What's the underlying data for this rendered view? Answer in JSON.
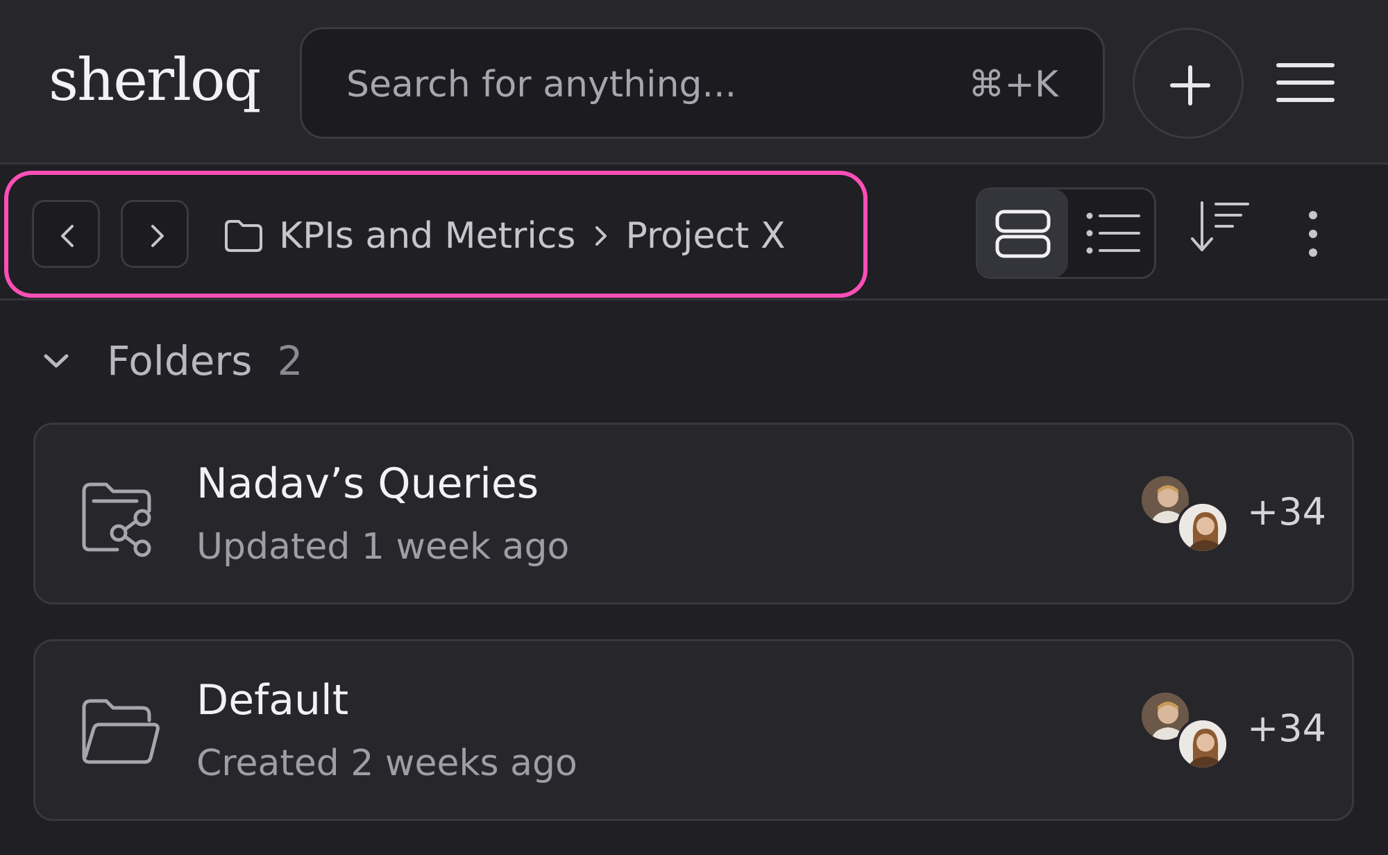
{
  "header": {
    "logo": "sherloq",
    "search_placeholder": "Search for anything...",
    "search_shortcut": "⌘+K",
    "add_icon": "plus-icon",
    "menu_icon": "hamburger-icon"
  },
  "toolbar": {
    "breadcrumb": [
      "KPIs and Metrics",
      "Project X"
    ],
    "view_modes": [
      "card-view",
      "list-view"
    ],
    "active_view": "card-view",
    "highlight_color": "#ff4fb6"
  },
  "section": {
    "title": "Folders",
    "count": "2"
  },
  "folders": [
    {
      "name": "Nadav’s Queries",
      "meta": "Updated 1 week ago",
      "icon": "shared-folder-icon",
      "members_extra": "+34"
    },
    {
      "name": "Default",
      "meta": "Created 2 weeks ago",
      "icon": "folder-open-icon",
      "members_extra": "+34"
    }
  ]
}
